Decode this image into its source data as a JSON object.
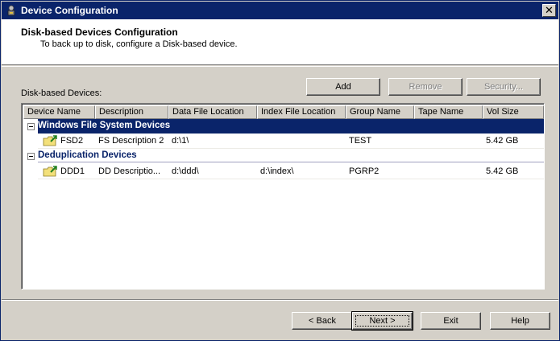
{
  "window": {
    "title": "Device Configuration",
    "close_label": "✕"
  },
  "header": {
    "title": "Disk-based Devices Configuration",
    "subtitle": "To back up to disk, configure a Disk-based device."
  },
  "devices_label": "Disk-based Devices:",
  "toolbar": {
    "add": "Add",
    "remove": "Remove",
    "security": "Security..."
  },
  "columns": [
    "Device Name",
    "Description",
    "Data File Location",
    "Index File Location",
    "Group Name",
    "Tape Name",
    "Vol Size"
  ],
  "groups": [
    {
      "label": "Windows File System Devices",
      "selected": true,
      "rows": [
        {
          "icon": "folder-device-icon",
          "device_name": "FSD2",
          "description": "FS Description 2",
          "data_file": "d:\\1\\",
          "index_file": "",
          "group_name": "TEST",
          "tape_name": "",
          "vol_size": "5.42 GB"
        }
      ]
    },
    {
      "label": "Deduplication Devices",
      "selected": false,
      "rows": [
        {
          "icon": "folder-device-icon",
          "device_name": "DDD1",
          "description": "DD Descriptio...",
          "data_file": "d:\\ddd\\",
          "index_file": "d:\\index\\",
          "group_name": "PGRP2",
          "tape_name": "",
          "vol_size": "5.42 GB"
        }
      ]
    }
  ],
  "footer": {
    "back": "< Back",
    "next": "Next >",
    "exit": "Exit",
    "help": "Help"
  },
  "colors": {
    "titlebar": "#0a246a",
    "selection": "#0a246a",
    "face": "#d4d0c8"
  }
}
